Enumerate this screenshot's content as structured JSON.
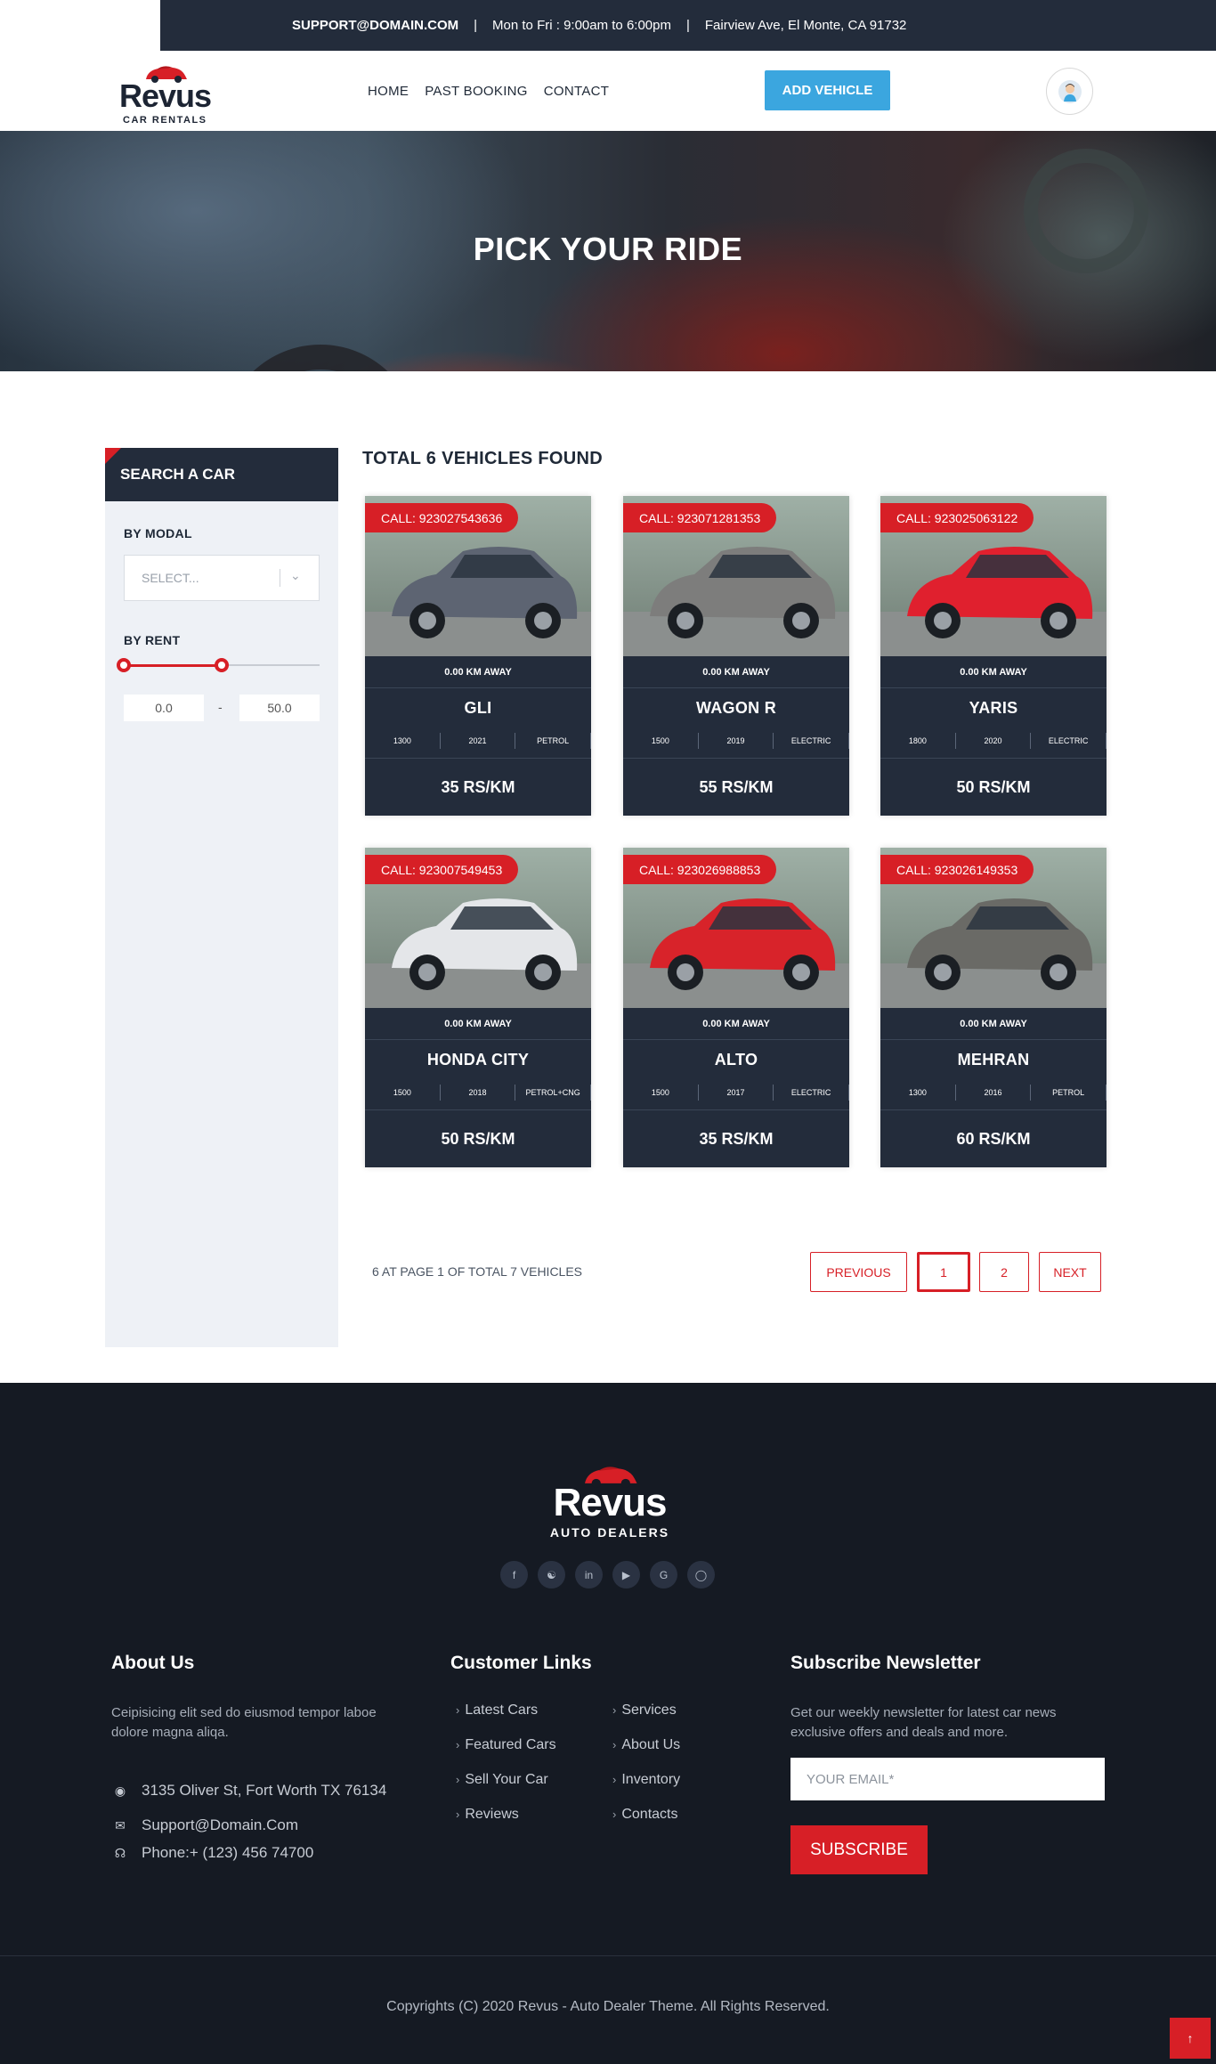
{
  "topbar": {
    "email": "SUPPORT@DOMAIN.COM",
    "hours": "Mon to Fri : 9:00am to 6:00pm",
    "address": "Fairview Ave, El Monte, CA 91732",
    "separator": "|"
  },
  "header": {
    "logo_word": "Revus",
    "logo_sub": "CAR RENTALS",
    "nav": [
      "HOME",
      "PAST BOOKING",
      "CONTACT"
    ],
    "add_vehicle": "ADD VEHICLE"
  },
  "hero": {
    "title": "PICK YOUR RIDE"
  },
  "sidebar": {
    "title": "SEARCH A CAR",
    "by_modal": "BY MODAL",
    "select_placeholder": "SELECT...",
    "by_rent": "BY RENT",
    "range_min": "0.0",
    "range_max": "50.0",
    "range_dash": "-",
    "slider_fraction": 0.5
  },
  "results": {
    "title": "TOTAL 6 VEHICLES FOUND",
    "cars": [
      {
        "call": "CALL: 923027543636",
        "distance": "0.00 KM AWAY",
        "name": "GLI",
        "specs": [
          "1300",
          "2021",
          "PETROL"
        ],
        "price": "35 RS/KM",
        "color": "#5d6472"
      },
      {
        "call": "CALL: 923071281353",
        "distance": "0.00 KM AWAY",
        "name": "WAGON R",
        "specs": [
          "1500",
          "2019",
          "ELECTRIC"
        ],
        "price": "55 RS/KM",
        "color": "#7d7d7c"
      },
      {
        "call": "CALL: 923025063122",
        "distance": "0.00 KM AWAY",
        "name": "YARIS",
        "specs": [
          "1800",
          "2020",
          "ELECTRIC"
        ],
        "price": "50 RS/KM",
        "color": "#e0202e"
      },
      {
        "call": "CALL: 923007549453",
        "distance": "0.00 KM AWAY",
        "name": "HONDA CITY",
        "specs": [
          "1500",
          "2018",
          "PETROL+CNG"
        ],
        "price": "50 RS/KM",
        "color": "#e4e6e9"
      },
      {
        "call": "CALL: 923026988853",
        "distance": "0.00 KM AWAY",
        "name": "ALTO",
        "specs": [
          "1500",
          "2017",
          "ELECTRIC"
        ],
        "price": "35 RS/KM",
        "color": "#d8232a"
      },
      {
        "call": "CALL: 923026149353",
        "distance": "0.00 KM AWAY",
        "name": "MEHRAN",
        "specs": [
          "1300",
          "2016",
          "PETROL"
        ],
        "price": "60 RS/KM",
        "color": "#6a6a66"
      }
    ]
  },
  "pagination": {
    "info": "6 AT PAGE 1 OF TOTAL 7 VEHICLES",
    "previous": "PREVIOUS",
    "pages": [
      "1",
      "2"
    ],
    "next": "NEXT"
  },
  "footer": {
    "logo_word": "Revus",
    "logo_sub": "AUTO DEALERS",
    "socials": [
      "facebook-icon",
      "twitter-icon",
      "linkedin-icon",
      "youtube-icon",
      "google-icon",
      "instagram-icon"
    ],
    "about_title": "About Us",
    "about_text": "Ceipisicing elit sed do eiusmod tempor laboe dolore magna aliqa.",
    "address": "3135 Oliver St, Fort Worth TX 76134",
    "email": "Support@Domain.Com",
    "phone": "Phone:+ (123) 456 74700",
    "links_title": "Customer Links",
    "links": [
      "Latest Cars",
      "Services",
      "Featured Cars",
      "About Us",
      "Sell Your Car",
      "Inventory",
      "Reviews",
      "Contacts"
    ],
    "news_title": "Subscribe Newsletter",
    "news_text": "Get our weekly newsletter for latest car news exclusive offers and deals and more.",
    "news_placeholder": "YOUR EMAIL*",
    "subscribe": "SUBSCRIBE",
    "copyright": "Copyrights (C) 2020 Revus - Auto Dealer Theme. All Rights Reserved."
  }
}
